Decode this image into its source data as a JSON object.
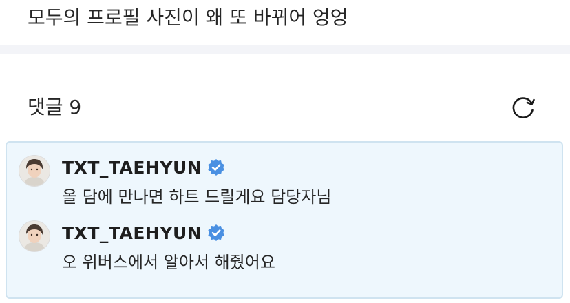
{
  "post": {
    "text": "모두의 프로필 사진이 왜 또 바뀌어 엉엉"
  },
  "comments_section": {
    "header": "댓글 9",
    "refresh_icon": "refresh-icon"
  },
  "comments": [
    {
      "author": "TXT_TAEHYUN",
      "verified": true,
      "text": "올 담에 만나면 하트 드릴게요 담당자님"
    },
    {
      "author": "TXT_TAEHYUN",
      "verified": true,
      "text": "오 위버스에서 알아서 해줬어요"
    }
  ],
  "colors": {
    "highlight_background": "#eef7fd",
    "highlight_border": "#cfe3f0",
    "verified_badge": "#4a90e2",
    "divider": "#f3f4f8"
  }
}
